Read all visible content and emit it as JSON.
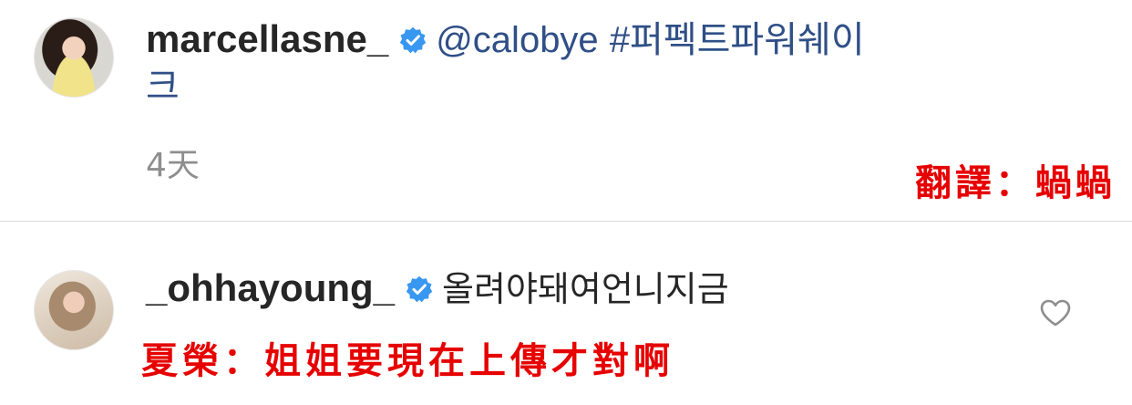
{
  "comments": [
    {
      "username": "marcellasne_",
      "mention": "@calobye",
      "hashtag_part1": "#퍼펙트파워쉐이",
      "hashtag_part2": "크",
      "time": "4天",
      "overlay_translation": "翻譯：蝸蝸"
    },
    {
      "username": "_ohhayoung_",
      "text": "올려야돼여언니지금",
      "overlay_translation": "夏榮：姐姐要現在上傳才對啊"
    }
  ],
  "colors": {
    "verified_badge": "#3897f0",
    "link": "#2f4f86",
    "overlay_text": "#e60000",
    "timestamp": "#8e8e8e"
  },
  "icons": {
    "verified": "verified-badge-icon",
    "like": "heart-outline-icon"
  }
}
